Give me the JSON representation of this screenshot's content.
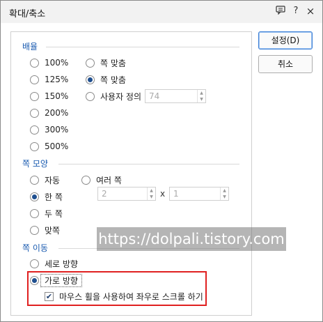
{
  "window": {
    "title": "확대/축소",
    "icons": {
      "help_box": "chat-box-icon",
      "help": "?",
      "close": "×"
    }
  },
  "magnification": {
    "group_label": "배율",
    "left_options": [
      "100%",
      "125%",
      "150%",
      "200%",
      "300%",
      "500%"
    ],
    "fit_width_label": "쪽 맞춤",
    "fit_page_label": "쪽 맞춤",
    "custom_label": "사용자 정의",
    "custom_value": "74"
  },
  "page_shape": {
    "group_label": "쪽 모양",
    "auto_label": "자동",
    "multi_label": "여러 쪽",
    "single_label": "한 쪽",
    "double_label": "두 쪽",
    "facing_label": "맞쪽",
    "cols_value": "2",
    "rows_value": "1",
    "x_label": "x"
  },
  "page_move": {
    "group_label": "쪽 이동",
    "vertical_label": "세로 방향",
    "horizontal_label": "가로 방향",
    "wheel_check_label": "마우스 휠을 사용하여 좌우로 스크롤 하기"
  },
  "buttons": {
    "ok_label": "설정(D)",
    "cancel_label": "취소"
  },
  "watermark": "https://dolpali.tistory.com",
  "colors": {
    "group_label": "#1a5bb0",
    "highlight_box": "#e02020",
    "radio_dot": "#1f4f8f"
  }
}
